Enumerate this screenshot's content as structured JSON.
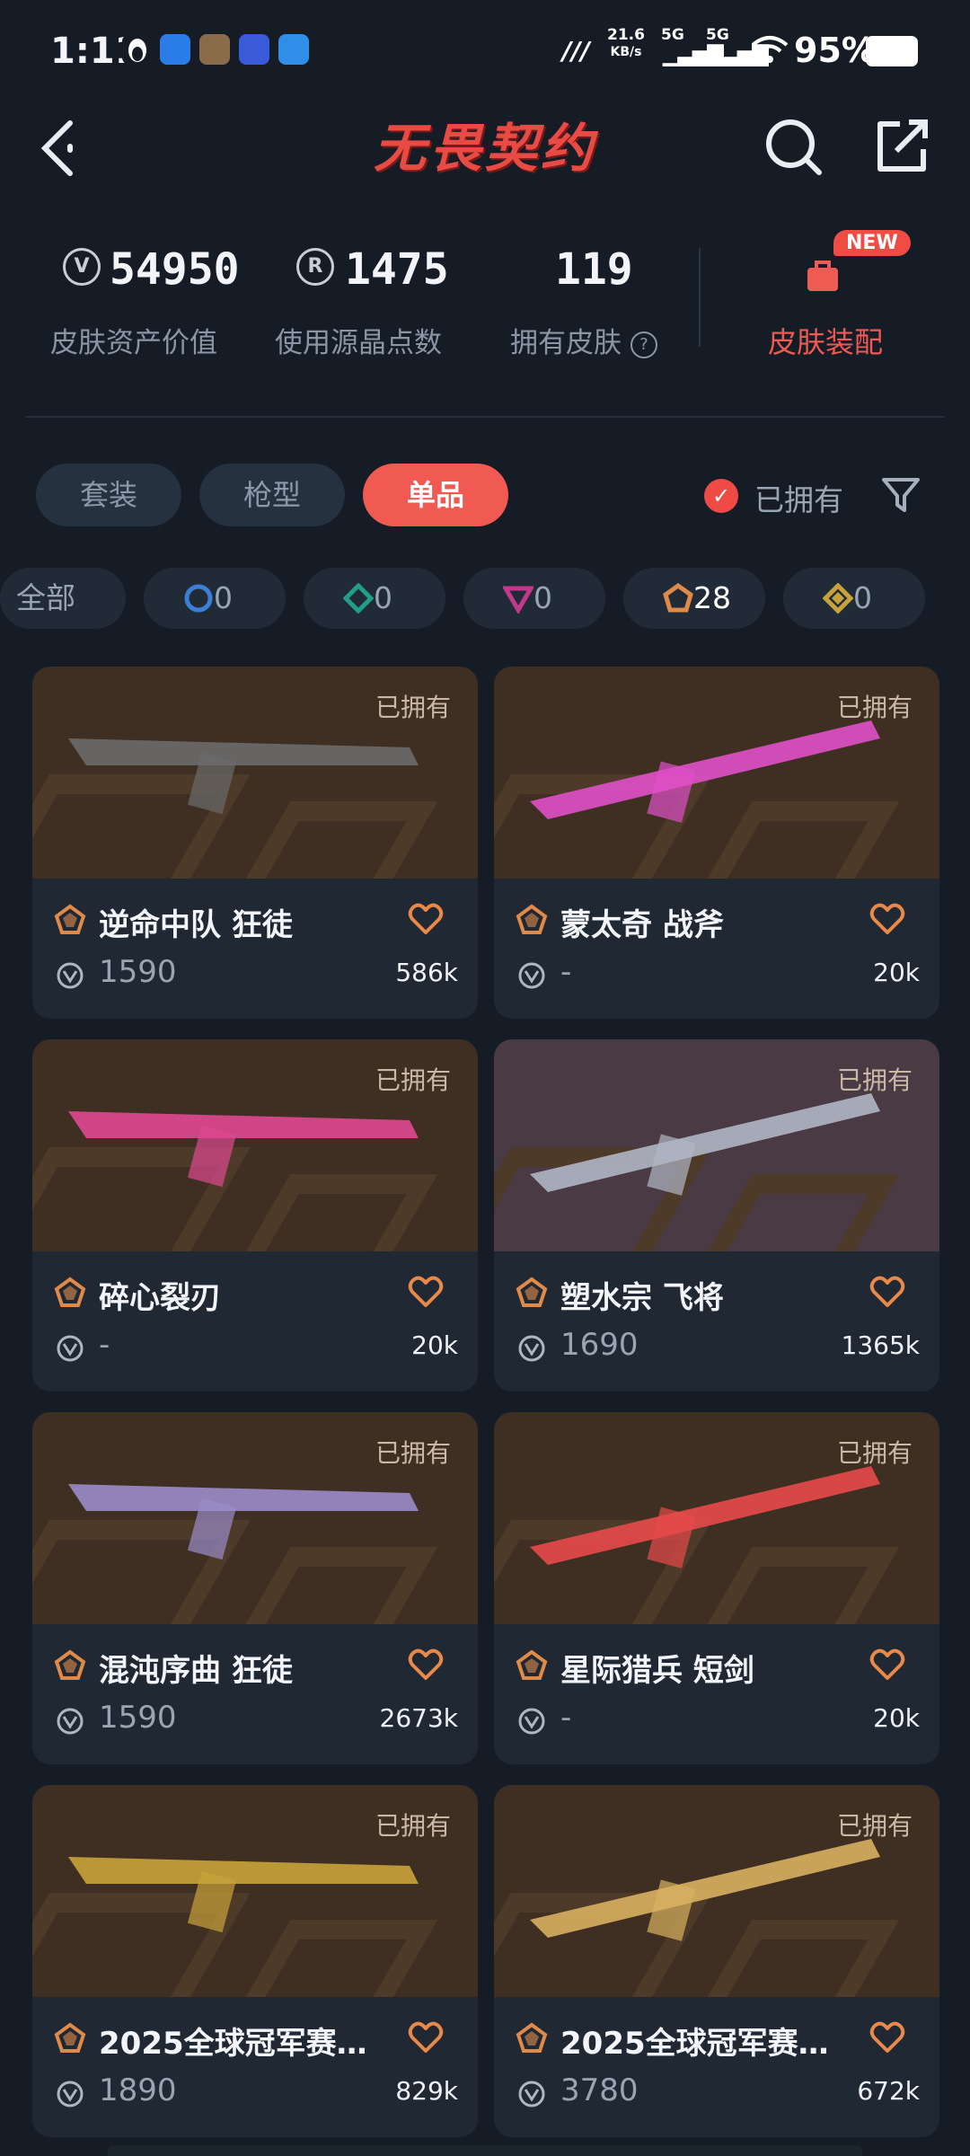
{
  "status_bar": {
    "time": "1:11",
    "net_speed_top": "21.6",
    "net_speed_unit": "KB/s",
    "net1": "5G",
    "net2": "5G",
    "battery": "95%"
  },
  "header": {
    "title": "无畏契约"
  },
  "stats": {
    "asset_value": "54950",
    "asset_label": "皮肤资产价值",
    "points": "1475",
    "points_label": "使用源晶点数",
    "skins": "119",
    "skins_label": "拥有皮肤",
    "equip_badge": "NEW",
    "equip_label": "皮肤装配"
  },
  "tabs": [
    {
      "label": "套装"
    },
    {
      "label": "枪型"
    },
    {
      "label": "单品",
      "active": true
    }
  ],
  "owned_filter_label": "已拥有",
  "rarity_chips": [
    {
      "label": "全部",
      "count": ""
    },
    {
      "label": "",
      "count": "0",
      "color": "#3b7fd6"
    },
    {
      "label": "",
      "count": "0",
      "color": "#1f9e8a"
    },
    {
      "label": "",
      "count": "0",
      "color": "#c2388a"
    },
    {
      "label": "",
      "count": "28",
      "color": "#e08a4a"
    },
    {
      "label": "",
      "count": "0",
      "color": "#c9a33a"
    }
  ],
  "cards": [
    {
      "owned": "已拥有",
      "name": "逆命中队 狂徒",
      "price": "1590",
      "likes": "586k"
    },
    {
      "owned": "已拥有",
      "name": "蒙太奇 战斧",
      "price": "-",
      "likes": "20k"
    },
    {
      "owned": "已拥有",
      "name": "碎心裂刃",
      "price": "-",
      "likes": "20k"
    },
    {
      "owned": "已拥有",
      "name": "塑水宗 飞将",
      "price": "1690",
      "likes": "1365k"
    },
    {
      "owned": "已拥有",
      "name": "混沌序曲 狂徒",
      "price": "1590",
      "likes": "2673k"
    },
    {
      "owned": "已拥有",
      "name": "星际猎兵 短剑",
      "price": "-",
      "likes": "20k"
    },
    {
      "owned": "已拥有",
      "name": "2025全球冠军赛…",
      "price": "1890",
      "likes": "829k"
    },
    {
      "owned": "已拥有",
      "name": "2025全球冠军赛…",
      "price": "3780",
      "likes": "672k"
    }
  ],
  "colors": {
    "accent": "#f05a52",
    "background": "#151c25",
    "card": "#1f2833"
  }
}
